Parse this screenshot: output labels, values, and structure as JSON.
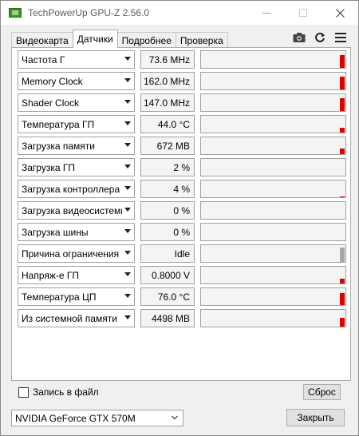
{
  "window": {
    "title": "TechPowerUp GPU-Z 2.56.0"
  },
  "tabs": [
    {
      "label": "Видеокарта",
      "active": false
    },
    {
      "label": "Датчики",
      "active": true
    },
    {
      "label": "Подробнее",
      "active": false
    },
    {
      "label": "Проверка",
      "active": false
    }
  ],
  "toolbar": {
    "icons": [
      "camera-icon",
      "refresh-icon",
      "menu-icon"
    ]
  },
  "sensors": [
    {
      "name": "Частота Г",
      "value": "73.6 MHz",
      "graph_level": 0.75,
      "graph_color": "#e00000"
    },
    {
      "name": "Memory Clock",
      "value": "162.0 MHz",
      "graph_level": 0.75,
      "graph_color": "#e00000"
    },
    {
      "name": "Shader Clock",
      "value": "147.0 MHz",
      "graph_level": 0.75,
      "graph_color": "#e00000"
    },
    {
      "name": "Температура ГП",
      "value": "44.0 °C",
      "graph_level": 0.3,
      "graph_color": "#e00000"
    },
    {
      "name": "Загрузка памяти",
      "value": "672 MB",
      "graph_level": 0.35,
      "graph_color": "#e00000"
    },
    {
      "name": "Загрузка ГП",
      "value": "2 %",
      "graph_level": 0.02,
      "graph_color": "#e00000"
    },
    {
      "name": "Загрузка контроллера памяти",
      "value": "4 %",
      "graph_level": 0.04,
      "graph_color": "#e00000"
    },
    {
      "name": "Загрузка видеосистемы",
      "value": "0 %",
      "graph_level": 0,
      "graph_color": "#e00000"
    },
    {
      "name": "Загрузка шины",
      "value": "0 %",
      "graph_level": 0,
      "graph_color": "#e00000"
    },
    {
      "name": "Причина ограничения",
      "value": "Idle",
      "graph_level": 0.85,
      "graph_color": "#a8a8a8"
    },
    {
      "name": "Напряж-е ГП",
      "value": "0.8000 V",
      "graph_level": 0.3,
      "graph_color": "#e00000"
    },
    {
      "name": "Температура ЦП",
      "value": "76.0 °C",
      "graph_level": 0.7,
      "graph_color": "#e00000"
    },
    {
      "name": "Из системной памяти",
      "value": "4498 MB",
      "graph_level": 0.5,
      "graph_color": "#e00000"
    }
  ],
  "log_to_file": {
    "label": "Запись в файл",
    "checked": false
  },
  "reset_button": {
    "label": "Сброс"
  },
  "gpu_select": {
    "value": "NVIDIA GeForce GTX 570M"
  },
  "close_button": {
    "label": "Закрыть"
  }
}
